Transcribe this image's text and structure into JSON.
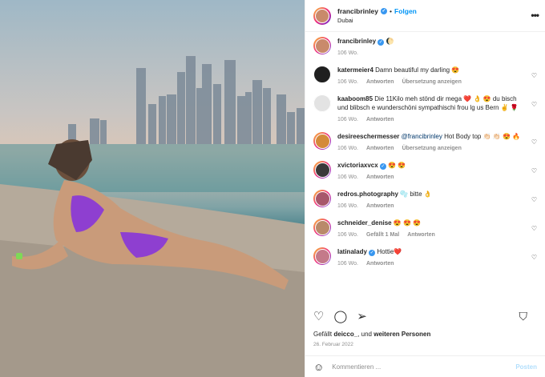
{
  "header": {
    "username": "francibrinley",
    "follow_label": "Folgen",
    "location": "Dubai",
    "more_label": "•••"
  },
  "caption": {
    "username": "francibrinley",
    "text": "🌔",
    "age": "106 Wo."
  },
  "comments": [
    {
      "username": "katermeier4",
      "mention": "",
      "text": "Damn beautiful my darling 😍",
      "age": "106 Wo.",
      "reply": "Antworten",
      "translate": "Übersetzung anzeigen",
      "likes": "",
      "verified": false,
      "avatar_color": "#1f1f1f",
      "ring": false
    },
    {
      "username": "kaaboom85",
      "mention": "",
      "text": "Die 11Kilo meh stönd dir mega ❤️ 👌 😍 du bisch und blibsch e wunderschöni sympathischi frou lg us Bern ✌️ 🌹",
      "age": "106 Wo.",
      "reply": "Antworten",
      "translate": "",
      "likes": "",
      "verified": false,
      "avatar_color": "#e3e3e3",
      "ring": false
    },
    {
      "username": "desireeschermesser",
      "mention": "@francibrinley",
      "text": "Hot Body top 👏🏻 👏🏻 😍 🔥",
      "age": "106 Wo.",
      "reply": "Antworten",
      "translate": "Übersetzung anzeigen",
      "likes": "",
      "verified": false,
      "avatar_color": "#d48a3a",
      "ring": true
    },
    {
      "username": "xvictoriaxvcx",
      "mention": "",
      "text": "😍 😍",
      "age": "106 Wo.",
      "reply": "Antworten",
      "translate": "",
      "likes": "",
      "verified": true,
      "avatar_color": "#3a3a3a",
      "ring": true
    },
    {
      "username": "redros.photography",
      "mention": "",
      "text": "🫧 bitte 👌",
      "age": "106 Wo.",
      "reply": "Antworten",
      "translate": "",
      "likes": "",
      "verified": false,
      "avatar_color": "#a8576b",
      "ring": true
    },
    {
      "username": "schneider_denise",
      "mention": "",
      "text": "😍 😍 😍",
      "age": "106 Wo.",
      "reply": "Antworten",
      "translate": "",
      "likes": "Gefällt 1 Mal",
      "verified": false,
      "avatar_color": "#b98a6a",
      "ring": true
    },
    {
      "username": "latinalady",
      "mention": "",
      "text": "Hottie❤️",
      "age": "106 Wo.",
      "reply": "Antworten",
      "translate": "",
      "likes": "",
      "verified": true,
      "avatar_color": "#c47a8a",
      "ring": true
    }
  ],
  "actions": {
    "like_icon": "heart-outline-icon",
    "comment_icon": "speech-bubble-icon",
    "share_icon": "paper-plane-icon",
    "save_icon": "bookmark-icon"
  },
  "likes": {
    "prefix": "Gefällt",
    "user": "deicco_",
    "middle": "und",
    "others": "weiteren Personen"
  },
  "date": "26. Februar 2022",
  "add_comment": {
    "placeholder": "Kommentieren ...",
    "post_label": "Posten"
  },
  "colors": {
    "accent": "#0095f6",
    "verified": "#3897f0",
    "muted": "#8e8e8e"
  }
}
